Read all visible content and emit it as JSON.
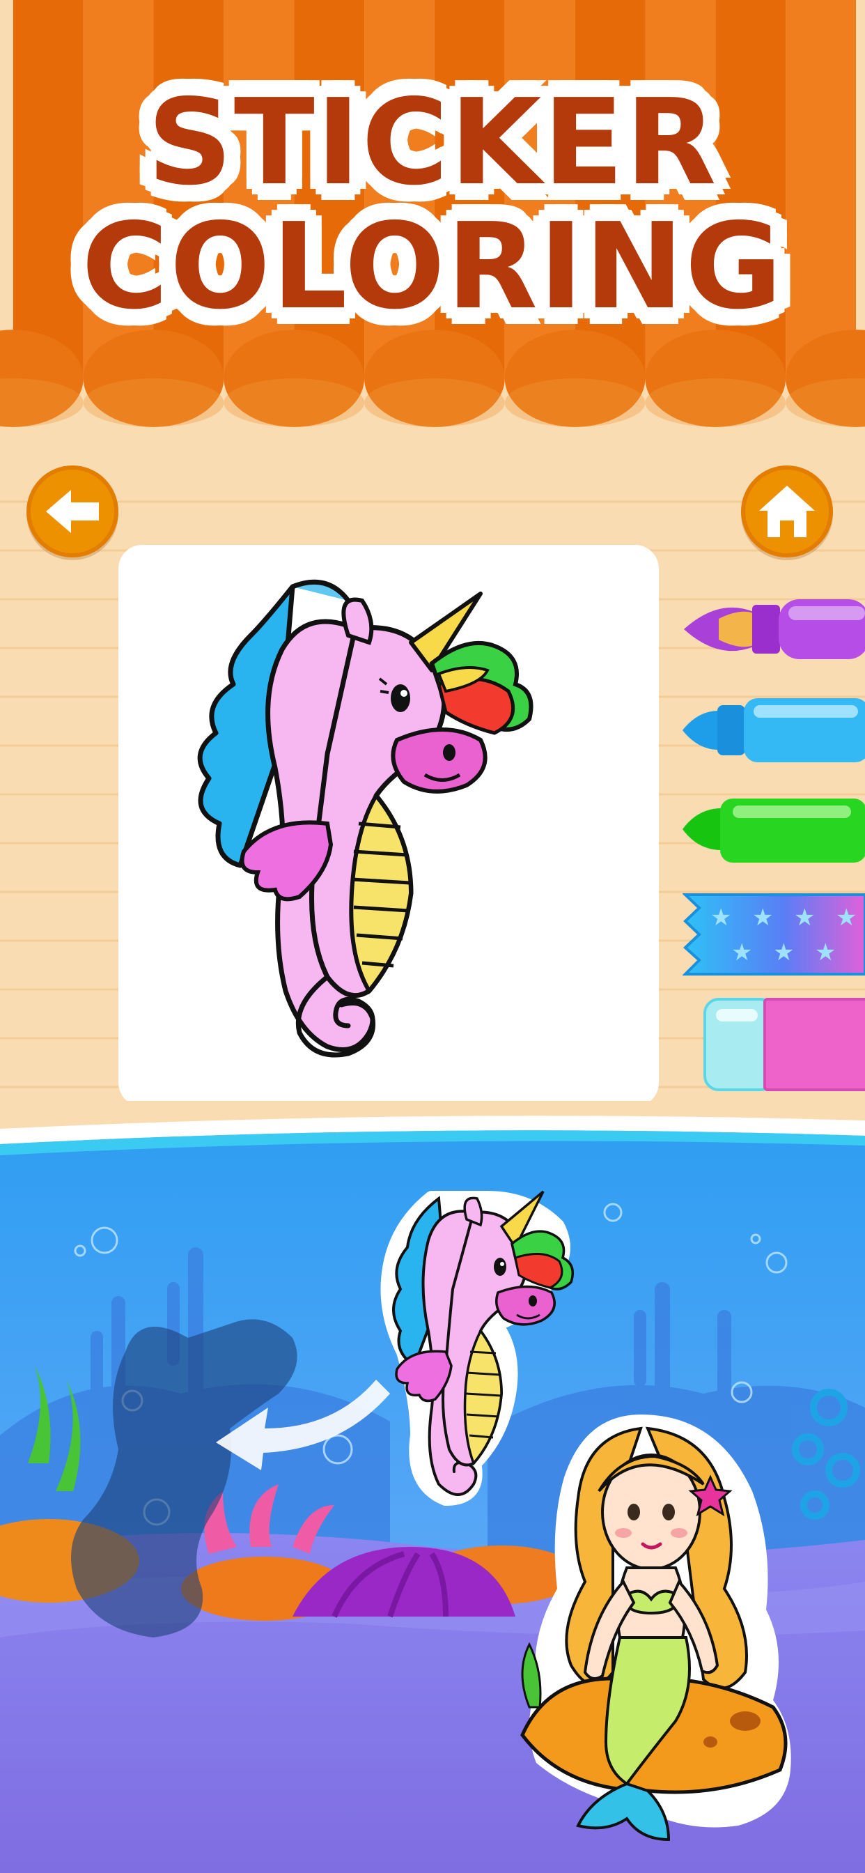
{
  "title": {
    "line1": "STICKER",
    "line2": "COLORING"
  },
  "nav": {
    "back_icon": "arrow-left-icon",
    "home_icon": "home-icon"
  },
  "tools": [
    {
      "name": "paint-brush",
      "color": "#a63be0"
    },
    {
      "name": "blue-marker",
      "color": "#1fa9ef"
    },
    {
      "name": "green-crayon",
      "color": "#1fcf16"
    },
    {
      "name": "star-pattern-tape",
      "color": "#2fb6f5"
    },
    {
      "name": "eraser",
      "color": "#ee63c9"
    }
  ],
  "colors": {
    "awning_dark": "#e16707",
    "awning_light": "#f07a1a",
    "title_text": "#b43a0c",
    "background": "#f9dcb2",
    "button": "#ee9100",
    "ocean_top": "#3aa0f1",
    "ocean_bottom": "#7e76e8"
  }
}
